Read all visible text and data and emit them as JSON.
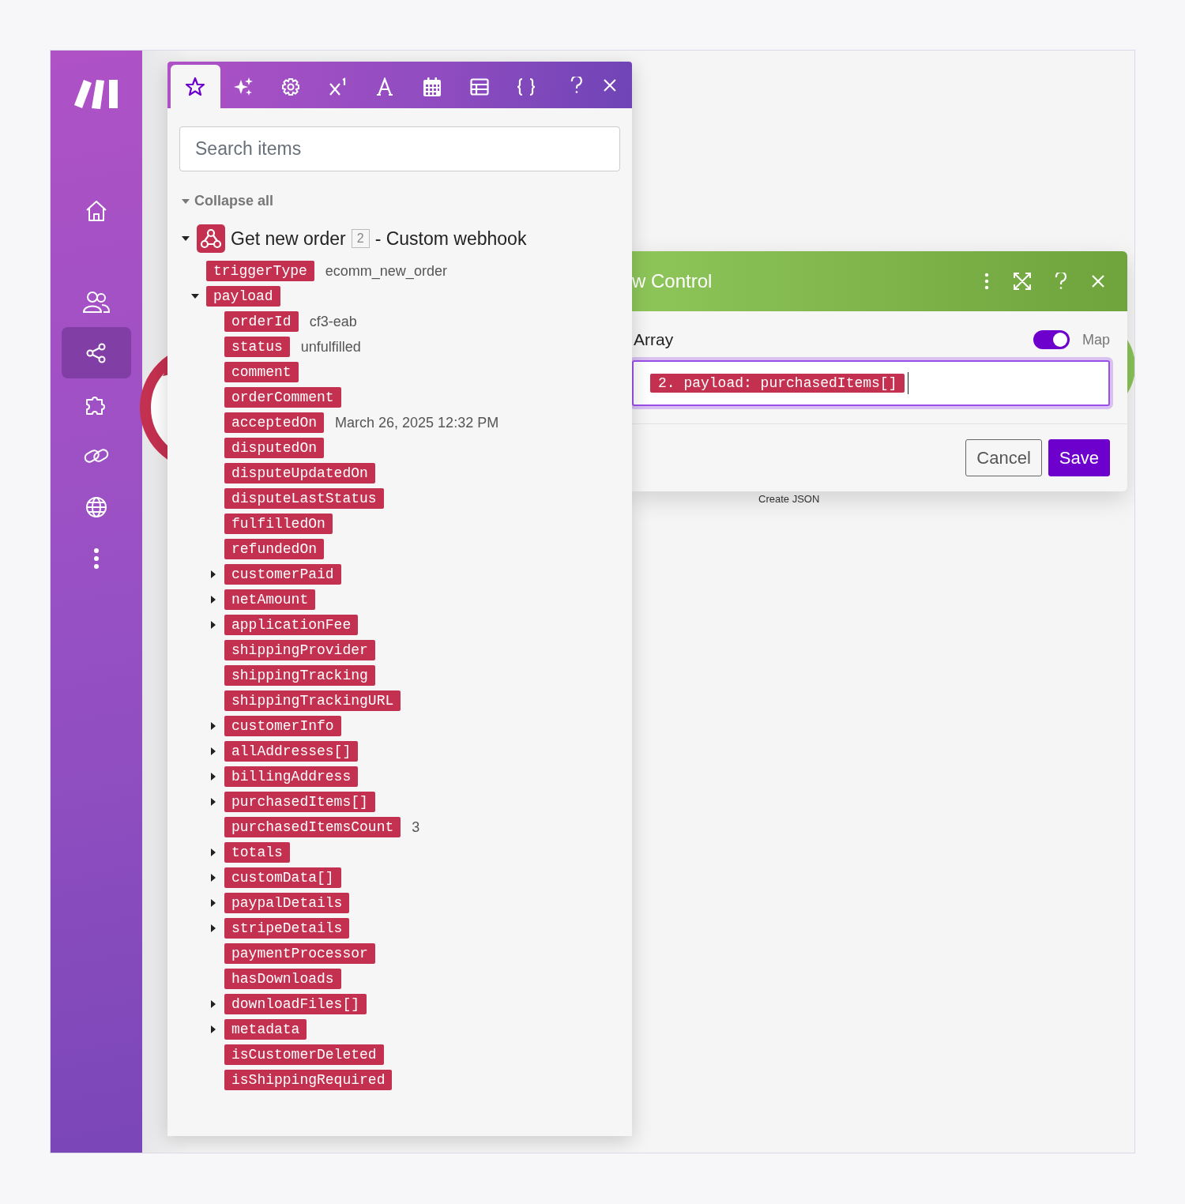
{
  "sidebar": {
    "items": [
      {
        "selected": false
      },
      {
        "selected": false
      },
      {
        "selected": true
      },
      {
        "selected": false
      },
      {
        "selected": false
      },
      {
        "selected": false
      },
      {
        "selected": false
      }
    ]
  },
  "mapping_panel": {
    "tabs": [
      {
        "selected": true
      },
      {
        "selected": false
      },
      {
        "selected": false
      },
      {
        "selected": false
      },
      {
        "selected": false
      },
      {
        "selected": false
      },
      {
        "selected": false
      },
      {
        "selected": false
      }
    ],
    "search": {
      "placeholder": "Search items"
    },
    "collapse_all": "Collapse all",
    "module": {
      "name": "Get new order",
      "number": "2",
      "type": "- Custom webhook",
      "expanded": true,
      "items": [
        {
          "name": "triggerType",
          "value": "ecomm_new_order"
        },
        {
          "name": "payload",
          "expanded": true,
          "children": [
            {
              "name": "orderId",
              "value": "cf3-eab"
            },
            {
              "name": "status",
              "value": "unfulfilled"
            },
            {
              "name": "comment"
            },
            {
              "name": "orderComment"
            },
            {
              "name": "acceptedOn",
              "value": "March 26, 2025 12:32 PM"
            },
            {
              "name": "disputedOn"
            },
            {
              "name": "disputeUpdatedOn"
            },
            {
              "name": "disputeLastStatus"
            },
            {
              "name": "fulfilledOn"
            },
            {
              "name": "refundedOn"
            },
            {
              "name": "customerPaid",
              "expanded": false
            },
            {
              "name": "netAmount",
              "expanded": false
            },
            {
              "name": "applicationFee",
              "expanded": false
            },
            {
              "name": "shippingProvider"
            },
            {
              "name": "shippingTracking"
            },
            {
              "name": "shippingTrackingURL"
            },
            {
              "name": "customerInfo",
              "expanded": false
            },
            {
              "name": "allAddresses[]",
              "expanded": false
            },
            {
              "name": "billingAddress",
              "expanded": false
            },
            {
              "name": "purchasedItems[]",
              "expanded": false
            },
            {
              "name": "purchasedItemsCount",
              "value": "3"
            },
            {
              "name": "totals",
              "expanded": false
            },
            {
              "name": "customData[]",
              "expanded": false
            },
            {
              "name": "paypalDetails",
              "expanded": false
            },
            {
              "name": "stripeDetails",
              "expanded": false
            },
            {
              "name": "paymentProcessor"
            },
            {
              "name": "hasDownloads"
            },
            {
              "name": "downloadFiles[]",
              "expanded": false
            },
            {
              "name": "metadata",
              "expanded": false
            },
            {
              "name": "isCustomerDeleted"
            },
            {
              "name": "isShippingRequired"
            }
          ]
        }
      ]
    }
  },
  "dialog": {
    "title": "w Control",
    "field": {
      "label": "Array",
      "map_toggle": {
        "on": true,
        "label": "Map"
      },
      "value": "2. payload: purchasedItems[]"
    },
    "buttons": [
      {
        "label": "Cancel",
        "kind": "secondary"
      },
      {
        "label": "Save",
        "kind": "primary"
      }
    ]
  },
  "canvas": {
    "caption": "Create JSON"
  }
}
